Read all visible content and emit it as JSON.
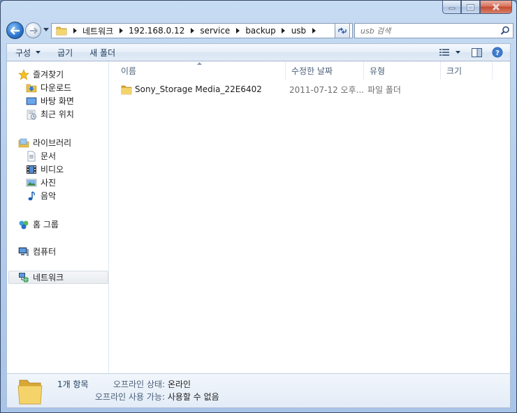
{
  "window": {
    "caption": {
      "minimize_icon": "minimize-icon",
      "maximize_icon": "maximize-icon",
      "close_icon": "close-icon"
    }
  },
  "navigation": {
    "breadcrumbs": [
      "네트워크",
      "192.168.0.12",
      "service",
      "backup",
      "usb"
    ],
    "search_placeholder": "usb 검색"
  },
  "toolbar": {
    "organize_label": "구성",
    "burn_label": "굽기",
    "new_folder_label": "새 폴더"
  },
  "sidebar": {
    "favorites": {
      "label": "즐겨찾기",
      "items": [
        "다운로드",
        "바탕 화면",
        "최근 위치"
      ]
    },
    "libraries": {
      "label": "라이브러리",
      "items": [
        "문서",
        "비디오",
        "사진",
        "음악"
      ]
    },
    "homegroup": {
      "label": "홈 그룹"
    },
    "computer": {
      "label": "컴퓨터"
    },
    "network": {
      "label": "네트워크",
      "selected": true
    }
  },
  "file_list": {
    "columns": [
      "이름",
      "수정한 날짜",
      "유형",
      "크기"
    ],
    "rows": [
      {
        "name": "Sony_Storage Media_22E6402",
        "date": "2011-07-12 오후...",
        "type": "파일 폴더",
        "size": ""
      }
    ]
  },
  "details": {
    "count": "1개 항목",
    "offline_status_label": "오프라인 상태:",
    "offline_status_value": "온라인",
    "offline_availability_label": "오프라인 사용 가능:",
    "offline_availability_value": "사용할 수 없음"
  },
  "colors": {
    "window_frame": "#b6cfee",
    "close_button": "#c44b32",
    "back_button": "#2e79d1",
    "folder_yellow": "#e8c04a",
    "header_text": "#4c607a"
  }
}
